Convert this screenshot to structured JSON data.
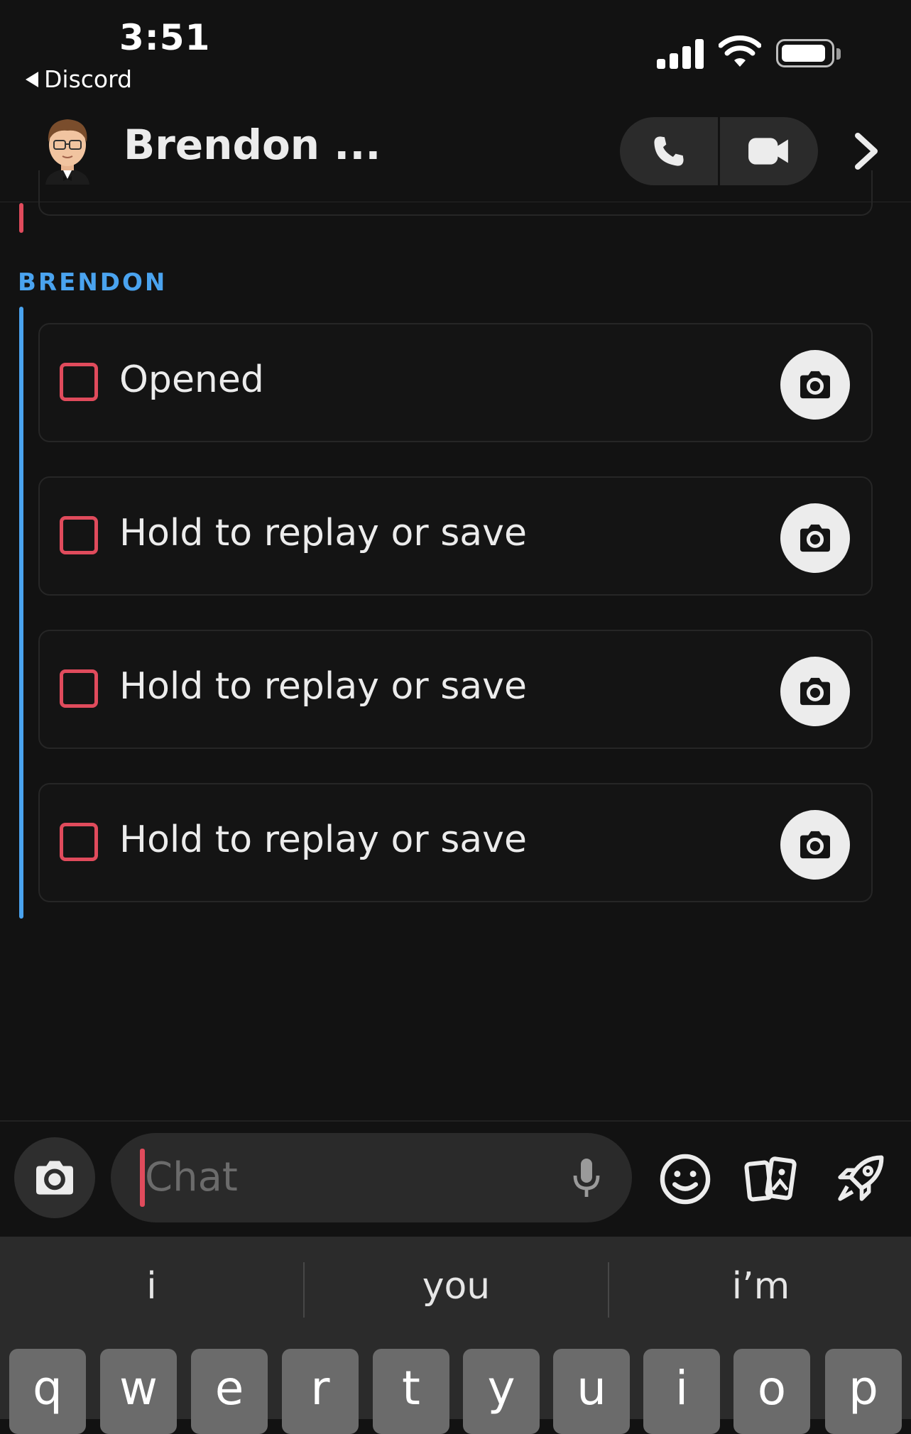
{
  "status_bar": {
    "time": "3:51",
    "back_app": "Discord"
  },
  "header": {
    "contact_name": "Brendon ...",
    "icons": [
      "phone-icon",
      "video-icon",
      "chevron-right-icon"
    ]
  },
  "conversation": {
    "sender": "BRENDON",
    "snaps": [
      {
        "label": "Opened"
      },
      {
        "label": "Hold to replay or save"
      },
      {
        "label": "Hold to replay or save"
      },
      {
        "label": "Hold to replay or save"
      }
    ]
  },
  "composer": {
    "placeholder": "Chat",
    "icons": [
      "camera-icon",
      "microphone-icon",
      "smiley-icon",
      "cards-icon",
      "rocket-icon"
    ]
  },
  "keyboard": {
    "suggestions": [
      "i",
      "you",
      "i’m"
    ],
    "row1": [
      "q",
      "w",
      "e",
      "r",
      "t",
      "y",
      "u",
      "i",
      "o",
      "p"
    ]
  },
  "colors": {
    "background": "#121212",
    "accent_red": "#e04b5c",
    "accent_blue": "#4aa3ef"
  }
}
